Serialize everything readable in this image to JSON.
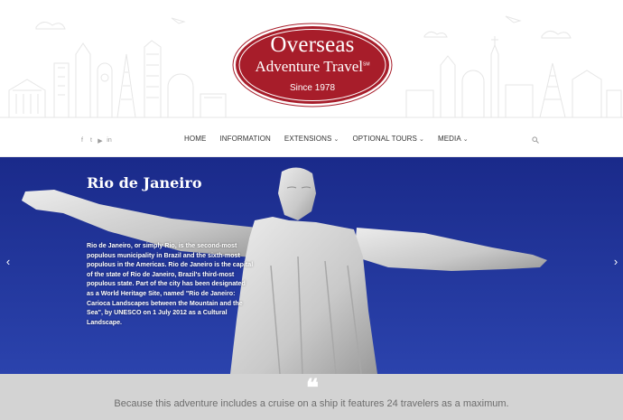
{
  "brand": {
    "line1": "Overseas",
    "line2": "Adventure Travel",
    "trademark": "SM",
    "since": "Since 1978",
    "color": "#a71d2a"
  },
  "social": {
    "icons": [
      "facebook-icon",
      "twitter-icon",
      "youtube-icon",
      "linkedin-icon"
    ],
    "glyphs": [
      "f",
      "t",
      "▶",
      "in"
    ]
  },
  "nav": {
    "items": [
      {
        "label": "HOME",
        "has_dropdown": false
      },
      {
        "label": "INFORMATION",
        "has_dropdown": false
      },
      {
        "label": "EXTENSIONS",
        "has_dropdown": true
      },
      {
        "label": "OPTIONAL TOURS",
        "has_dropdown": true
      },
      {
        "label": "MEDIA",
        "has_dropdown": true
      }
    ],
    "chevron": "⌄"
  },
  "hero": {
    "title": "Rio de Janeiro",
    "text": "Rio de Janeiro, or simply Rio, is the second-most populous municipality in Brazil and the sixth-most populous in the Americas. Rio de Janeiro is the capital of the state of Rio de Janeiro, Brazil's third-most populous state. Part of the city has been designated as a World Heritage Site, named \"Rio de Janeiro: Carioca Landscapes between the Mountain and the Sea\", by UNESCO on 1 July 2012 as a Cultural Landscape.",
    "prev_arrow": "‹",
    "next_arrow": "›",
    "sky_color": "#1f34a0"
  },
  "quote": {
    "mark": "❝",
    "text": "Because this adventure includes a cruise on a ship it features 24 travelers as a maximum."
  }
}
